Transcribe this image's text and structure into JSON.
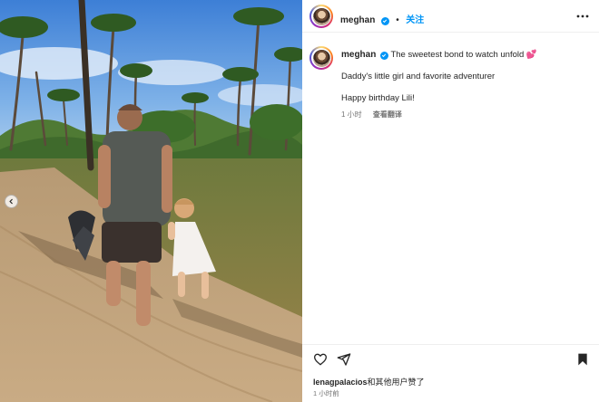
{
  "post": {
    "username": "meghan",
    "follow_label": "关注",
    "separator": "•",
    "caption": {
      "author": "meghan",
      "line1": "The sweetest bond to watch unfold 💕",
      "line2": "Daddy's little girl and favorite adventurer",
      "line3": "Happy birthday Lili!"
    },
    "comment_meta": {
      "time": "1 小时",
      "translate_label": "查看翻译"
    },
    "likes": {
      "user": "lenagpalacios",
      "suffix": "和其他用户赞了"
    },
    "posted_time": "1 小时前"
  },
  "icons": {
    "verified": "verified-badge-icon",
    "more": "more-options-icon",
    "like": "heart-icon",
    "share": "share-icon",
    "save": "bookmark-icon",
    "carousel_prev": "chevron-left-icon"
  },
  "colors": {
    "accent": "#0095f6",
    "text": "#262626",
    "secondary": "#737373",
    "divider": "#efefef"
  }
}
